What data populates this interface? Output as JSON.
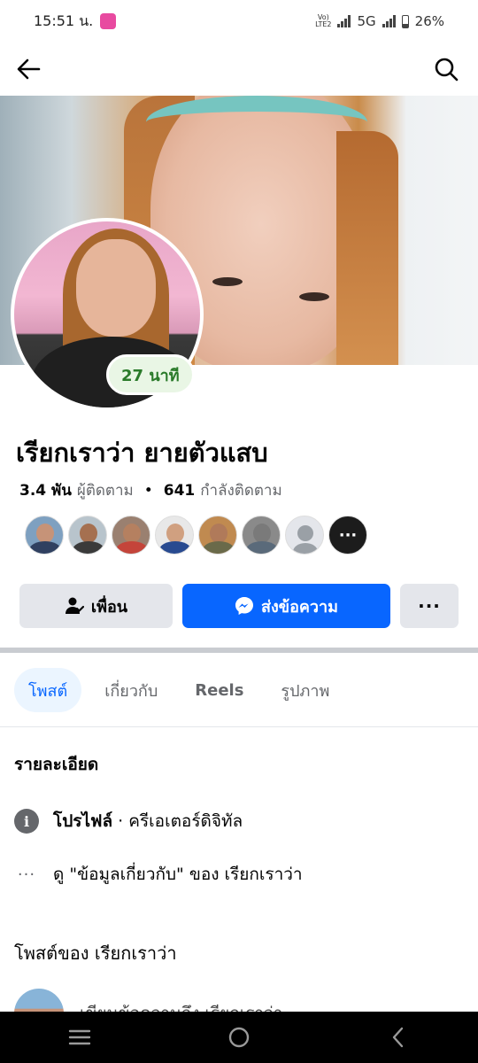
{
  "status_bar": {
    "time": "15:51 น.",
    "app_badge": "GSB",
    "volte": "Vo) LTE2",
    "network": "5G",
    "battery": "26%"
  },
  "icons": {
    "back": "arrow-left-icon",
    "search": "search-icon",
    "friend": "person-check-icon",
    "messenger": "messenger-icon",
    "info": "info-icon"
  },
  "profile": {
    "name": "เรียกเราว่า ยายตัวแสบ",
    "story_badge": "27 นาที",
    "followers_count": "3.4 พัน",
    "followers_label": "ผู้ติดตาม",
    "following_count": "641",
    "following_label": "กำลังติดตาม",
    "separator": "•"
  },
  "mutual_friends": {
    "more_label": "···"
  },
  "actions": {
    "friend_label": "เพื่อน",
    "message_label": "ส่งข้อความ",
    "more_label": "···"
  },
  "tabs": [
    {
      "label": "โพสต์"
    },
    {
      "label": "เกี่ยวกับ"
    },
    {
      "label": "Reels"
    },
    {
      "label": "รูปภาพ"
    }
  ],
  "details": {
    "title": "รายละเอียด",
    "profile_bold": "โปรไฟล์",
    "profile_rest": "· ครีเอเตอร์ดิจิทัล",
    "about_link": "ดู \"ข้อมูลเกี่ยวกับ\" ของ เรียกเราว่า"
  },
  "posts": {
    "title": "โพสต์ของ เรียกเราว่า",
    "preview": "เขียนข้อความถึง เรียกเราว่า"
  },
  "colors": {
    "accent": "#0866ff",
    "secondary_button": "#e4e6eb",
    "story_badge_text": "#2a7a2a"
  }
}
